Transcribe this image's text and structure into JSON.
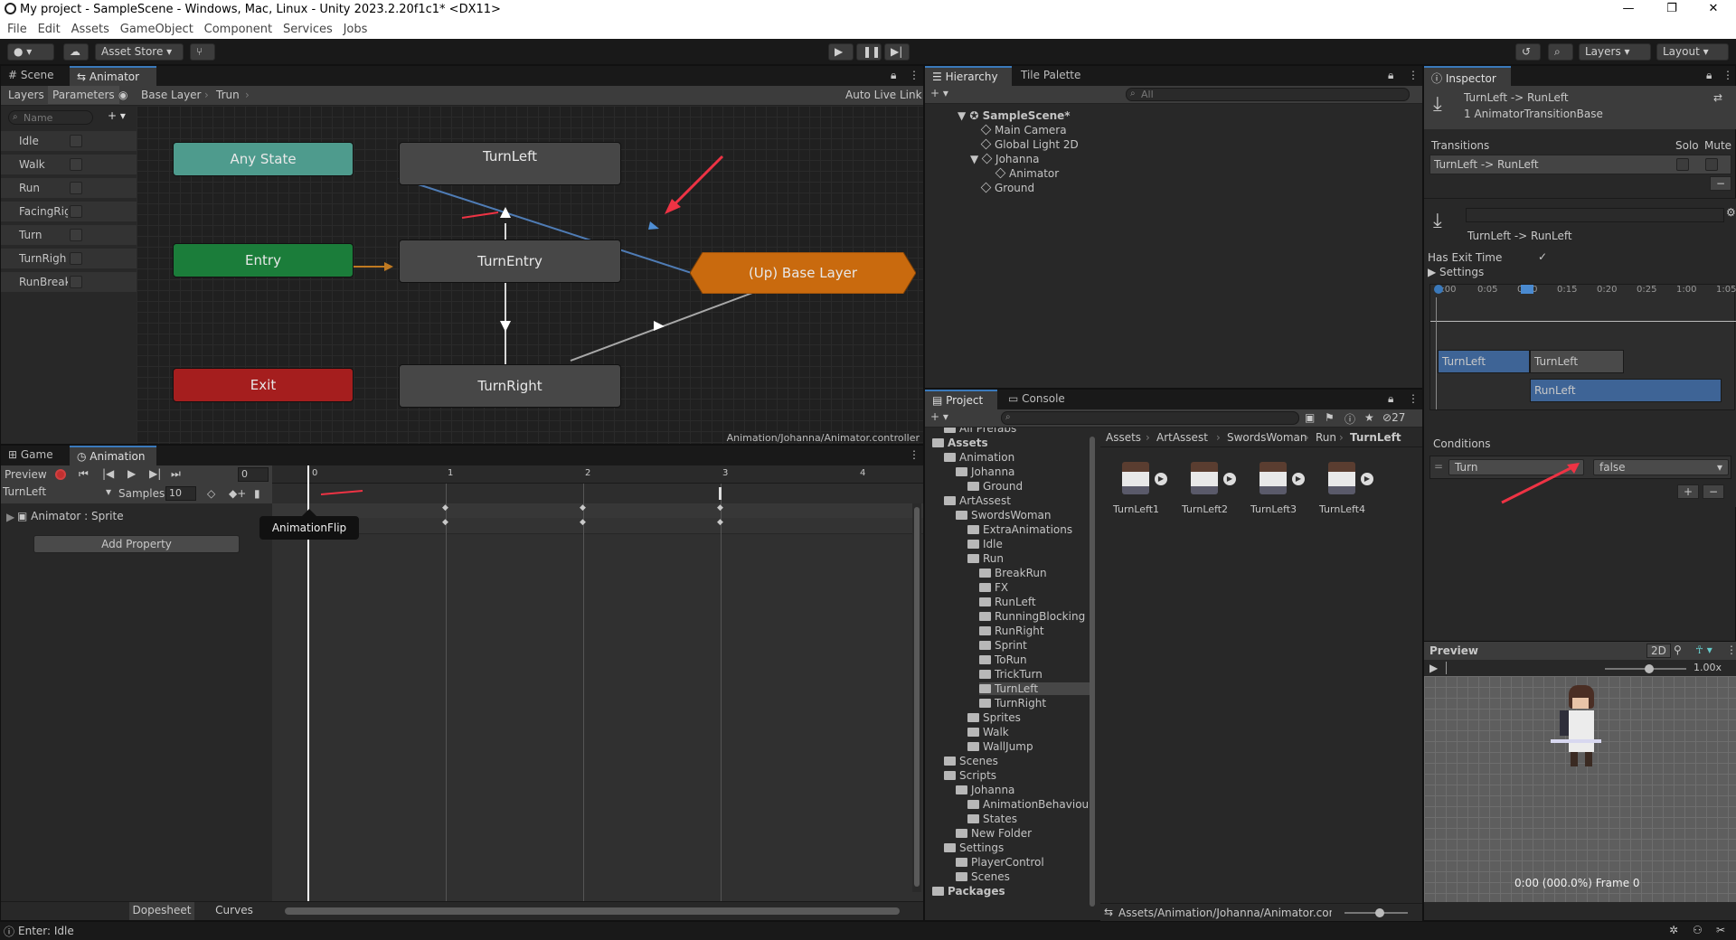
{
  "window": {
    "title": "My project - SampleScene - Windows, Mac, Linux - Unity 2023.2.20f1c1* <DX11>"
  },
  "menu": [
    "File",
    "Edit",
    "Assets",
    "GameObject",
    "Component",
    "Services",
    "Jobs"
  ],
  "toolbar": {
    "asset_store": "Asset Store",
    "layers": "Layers",
    "layout": "Layout"
  },
  "animator": {
    "tabs": [
      "Scene",
      "Animator"
    ],
    "subtabs": [
      "Layers",
      "Parameters"
    ],
    "breadcrumb": [
      "Base Layer",
      "Trun"
    ],
    "auto_live_link": "Auto Live Link",
    "search_placeholder": "Name",
    "parameters": [
      "Idle",
      "Walk",
      "Run",
      "FacingRig",
      "Turn",
      "TurnRigh",
      "RunBreak"
    ],
    "nodes": {
      "any_state": "Any State",
      "entry": "Entry",
      "exit": "Exit",
      "turn_left": "TurnLeft",
      "turn_entry": "TurnEntry",
      "turn_right": "TurnRight",
      "up_base": "(Up) Base Layer"
    },
    "status_path": "Animation/Johanna/Animator.controller",
    "colors": {
      "any_state": "#4e9b8d",
      "entry": "#1b7d3a",
      "exit": "#a51e1e",
      "state": "#444444",
      "up": "#c96a0e"
    }
  },
  "animation": {
    "tabs": [
      "Game",
      "Animation"
    ],
    "preview": "Preview",
    "frame": "0",
    "clip": "TurnLeft",
    "samples_label": "Samples",
    "samples": "10",
    "property": "Animator : Sprite",
    "add_property": "Add Property",
    "tooltip": "AnimationFlip",
    "ruler": [
      "0",
      "1",
      "2",
      "3",
      "4"
    ],
    "footer_tabs": [
      "Dopesheet",
      "Curves"
    ]
  },
  "hierarchy": {
    "tabs": [
      "Hierarchy",
      "Tile Palette"
    ],
    "search_placeholder": "All",
    "items": [
      {
        "label": "SampleScene*",
        "depth": 0
      },
      {
        "label": "Main Camera",
        "depth": 1
      },
      {
        "label": "Global Light 2D",
        "depth": 1
      },
      {
        "label": "Johanna",
        "depth": 1
      },
      {
        "label": "Animator",
        "depth": 2
      },
      {
        "label": "Ground",
        "depth": 1
      }
    ]
  },
  "project": {
    "tabs": [
      "Project",
      "Console"
    ],
    "count": "27",
    "tree": [
      {
        "label": "All Prefabs",
        "depth": 1
      },
      {
        "label": "Assets",
        "depth": 0
      },
      {
        "label": "Animation",
        "depth": 1
      },
      {
        "label": "Johanna",
        "depth": 2
      },
      {
        "label": "Ground",
        "depth": 3
      },
      {
        "label": "ArtAssest",
        "depth": 1
      },
      {
        "label": "SwordsWoman",
        "depth": 2
      },
      {
        "label": "ExtraAnimations",
        "depth": 3
      },
      {
        "label": "Idle",
        "depth": 3
      },
      {
        "label": "Run",
        "depth": 3
      },
      {
        "label": "BreakRun",
        "depth": 4
      },
      {
        "label": "FX",
        "depth": 4
      },
      {
        "label": "RunLeft",
        "depth": 4
      },
      {
        "label": "RunningBlocking",
        "depth": 4
      },
      {
        "label": "RunRight",
        "depth": 4
      },
      {
        "label": "Sprint",
        "depth": 4
      },
      {
        "label": "ToRun",
        "depth": 4
      },
      {
        "label": "TrickTurn",
        "depth": 4
      },
      {
        "label": "TurnLeft",
        "depth": 4
      },
      {
        "label": "TurnRight",
        "depth": 4
      },
      {
        "label": "Sprites",
        "depth": 3
      },
      {
        "label": "Walk",
        "depth": 3
      },
      {
        "label": "WallJump",
        "depth": 3
      },
      {
        "label": "Scenes",
        "depth": 1
      },
      {
        "label": "Scripts",
        "depth": 1
      },
      {
        "label": "Johanna",
        "depth": 2
      },
      {
        "label": "AnimationBehaviour",
        "depth": 3
      },
      {
        "label": "States",
        "depth": 3
      },
      {
        "label": "New Folder",
        "depth": 2
      },
      {
        "label": "Settings",
        "depth": 1
      },
      {
        "label": "PlayerControl",
        "depth": 2
      },
      {
        "label": "Scenes",
        "depth": 2
      },
      {
        "label": "Packages",
        "depth": 0
      }
    ],
    "breadcrumb": [
      "Assets",
      "ArtAssest",
      "SwordsWoman",
      "Run",
      "TurnLeft"
    ],
    "assets": [
      "TurnLeft1",
      "TurnLeft2",
      "TurnLeft3",
      "TurnLeft4"
    ],
    "footer_path": "Assets/Animation/Johanna/Animator.controlle"
  },
  "inspector": {
    "tab": "Inspector",
    "title": "TurnLeft -> RunLeft",
    "subtitle": "1 AnimatorTransitionBase",
    "transitions_label": "Transitions",
    "solo": "Solo",
    "mute": "Mute",
    "transition_item": "TurnLeft -> RunLeft",
    "transition_name": "TurnLeft -> RunLeft",
    "has_exit_time": "Has Exit Time",
    "settings": "Settings",
    "timeline_ticks": [
      "0:00",
      "0:05",
      "0:10",
      "0:15",
      "0:20",
      "0:25",
      "1:00",
      "1:05"
    ],
    "clip_from_1": "TurnLeft",
    "clip_from_2": "TurnLeft",
    "clip_to": "RunLeft",
    "conditions_label": "Conditions",
    "condition_param": "Turn",
    "condition_value": "false",
    "preview_label": "Preview",
    "preview_mode": "2D",
    "speed": "1.00x",
    "preview_status": "0:00 (000.0%) Frame 0"
  },
  "statusbar": {
    "text": "Enter: Idle"
  }
}
